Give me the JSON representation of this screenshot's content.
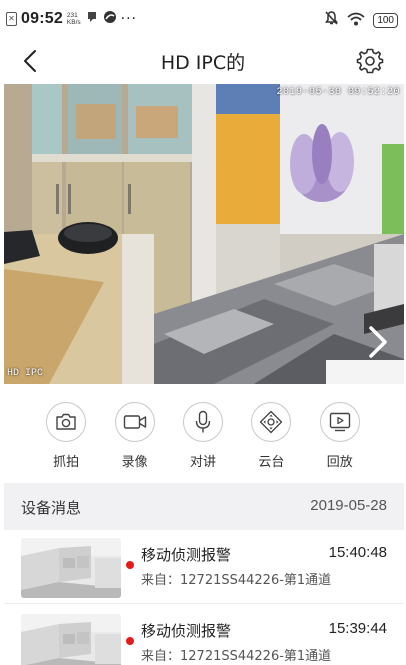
{
  "status_bar": {
    "time": "09:52",
    "speed_value": "231",
    "speed_unit": "KB/s",
    "more": "···",
    "battery": "100"
  },
  "header": {
    "title": "HD IPC的",
    "back_icon": "chevron-left-icon",
    "settings_icon": "gear-icon"
  },
  "video": {
    "timestamp": "2019-05-30 09:52:20",
    "channel_label": "HD IPC",
    "next_icon": "chevron-right-icon"
  },
  "controls": [
    {
      "label": "抓拍",
      "icon": "camera-icon"
    },
    {
      "label": "录像",
      "icon": "video-camera-icon"
    },
    {
      "label": "对讲",
      "icon": "microphone-icon"
    },
    {
      "label": "云台",
      "icon": "ptz-direction-icon"
    },
    {
      "label": "回放",
      "icon": "playback-icon"
    }
  ],
  "messages": {
    "header_title": "设备消息",
    "date": "2019-05-28",
    "items": [
      {
        "title": "移动侦测报警",
        "time": "15:40:48",
        "source": "来自：12721SS44226-第1通道"
      },
      {
        "title": "移动侦测报警",
        "time": "15:39:44",
        "source": "来自：12721SS44226-第1通道"
      }
    ]
  },
  "colors": {
    "alert_dot": "#e31b1b",
    "section_bg": "#f1f1f3"
  }
}
